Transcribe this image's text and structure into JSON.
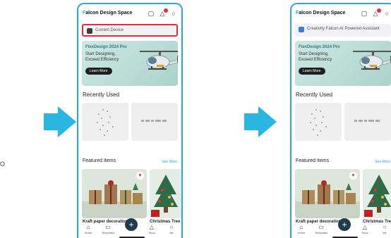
{
  "colors": {
    "accent": "#29b6e0",
    "highlight": "#d8323c",
    "badge": "#e0303a",
    "fab": "#1f3b4d"
  },
  "stray_label": "O",
  "panels": [
    {
      "app_title": "Falcon Design Space",
      "search_text": "Current Device",
      "search_highlighted": true,
      "banner": {
        "title": "FlexDesign 2024 Pro",
        "line1": "Start Designing,",
        "line2": "Exceed Efficiency",
        "button": "Learn More"
      },
      "recent_title": "Recently Used",
      "recent_items": [
        {
          "title": "",
          "sub": ""
        },
        {
          "title": "",
          "sub": ""
        }
      ],
      "featured_title": "Featured Items",
      "see_all": "See More",
      "featured_captions": [
        "Kraft paper decoration",
        "Christmas Tree"
      ],
      "nav": [
        "Home",
        "Templates",
        "",
        "Shop",
        "Me"
      ]
    },
    {
      "app_title": "Falcon Design Space",
      "search_text": "Creativity Falcon AI Powered Assistant",
      "search_highlighted": false,
      "banner": {
        "title": "FlexDesign 2024 Pro",
        "line1": "Start Designing,",
        "line2": "Exceed Efficiency",
        "button": "Learn More"
      },
      "recent_title": "Recently Used",
      "recent_items": [
        {
          "title": "",
          "sub": ""
        },
        {
          "title": "",
          "sub": ""
        }
      ],
      "featured_title": "Featured Items",
      "see_all": "See More",
      "featured_captions": [
        "Kraft paper decoration",
        "Christmas Tree"
      ],
      "nav": [
        "Home",
        "Templates",
        "",
        "Shop",
        "Me"
      ]
    }
  ]
}
